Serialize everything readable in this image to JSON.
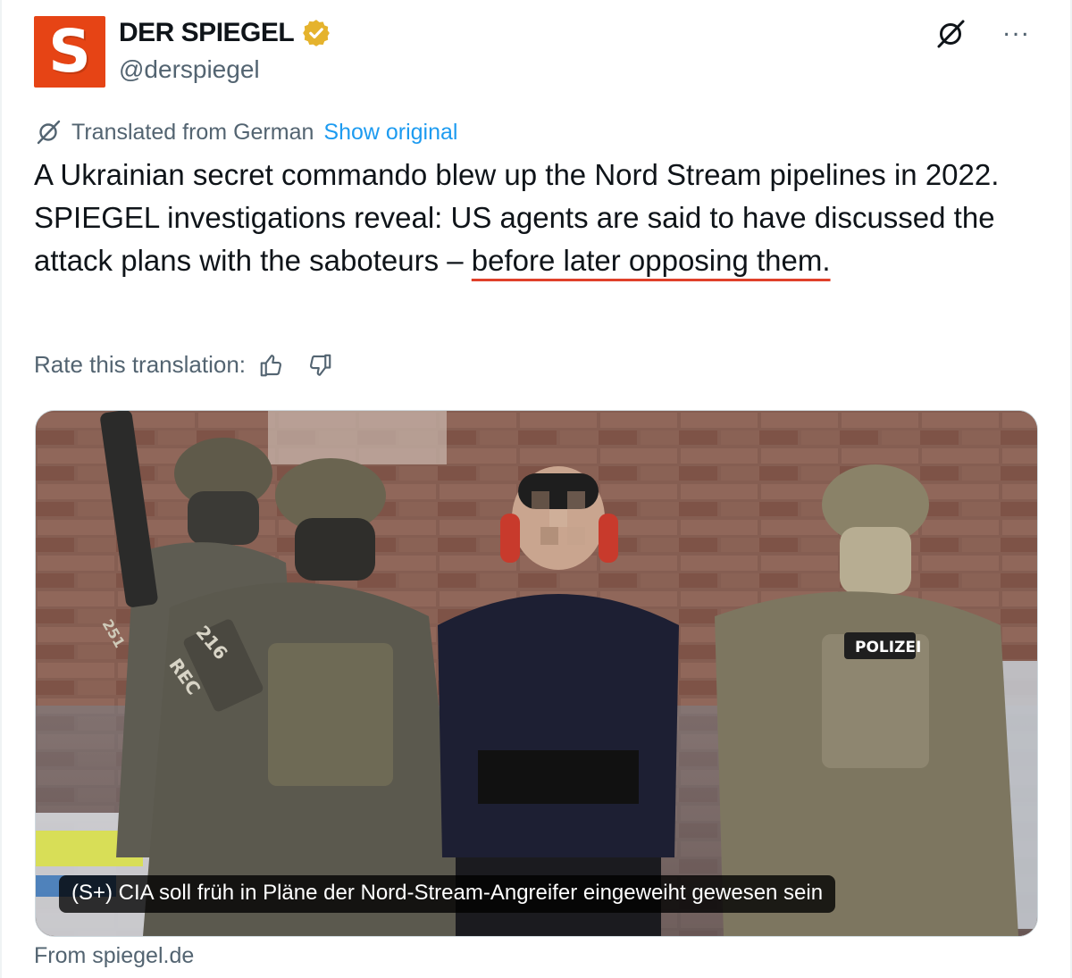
{
  "author": {
    "display_name": "DER SPIEGEL",
    "handle": "@derspiegel",
    "logo_letter": "S",
    "logo_color": "#e64415",
    "verified_badge": "gold-verified-icon"
  },
  "translation": {
    "label": "Translated from German",
    "show_original": "Show original"
  },
  "tweet": {
    "text_part1": "A Ukrainian secret commando blew up the Nord Stream pipelines in 2022. SPIEGEL investigations reveal: US agents are said to have discussed the attack plans with the saboteurs – ",
    "text_underlined": "before later opposing them."
  },
  "rating": {
    "label": "Rate this translation:",
    "thumbs_up_icon": "thumbs-up-icon",
    "thumbs_down_icon": "thumbs-down-icon"
  },
  "media": {
    "caption": "(S+) CIA soll früh in Pläne der Nord-Stream-Angreifer eingeweiht gewesen sein",
    "source": "From spiegel.de",
    "patch_labels": [
      "POLIZEI",
      "216",
      "REC",
      "251"
    ]
  },
  "colors": {
    "link": "#1d9bf0",
    "secondary_text": "#536471",
    "annotation_underline": "#e0402a"
  }
}
